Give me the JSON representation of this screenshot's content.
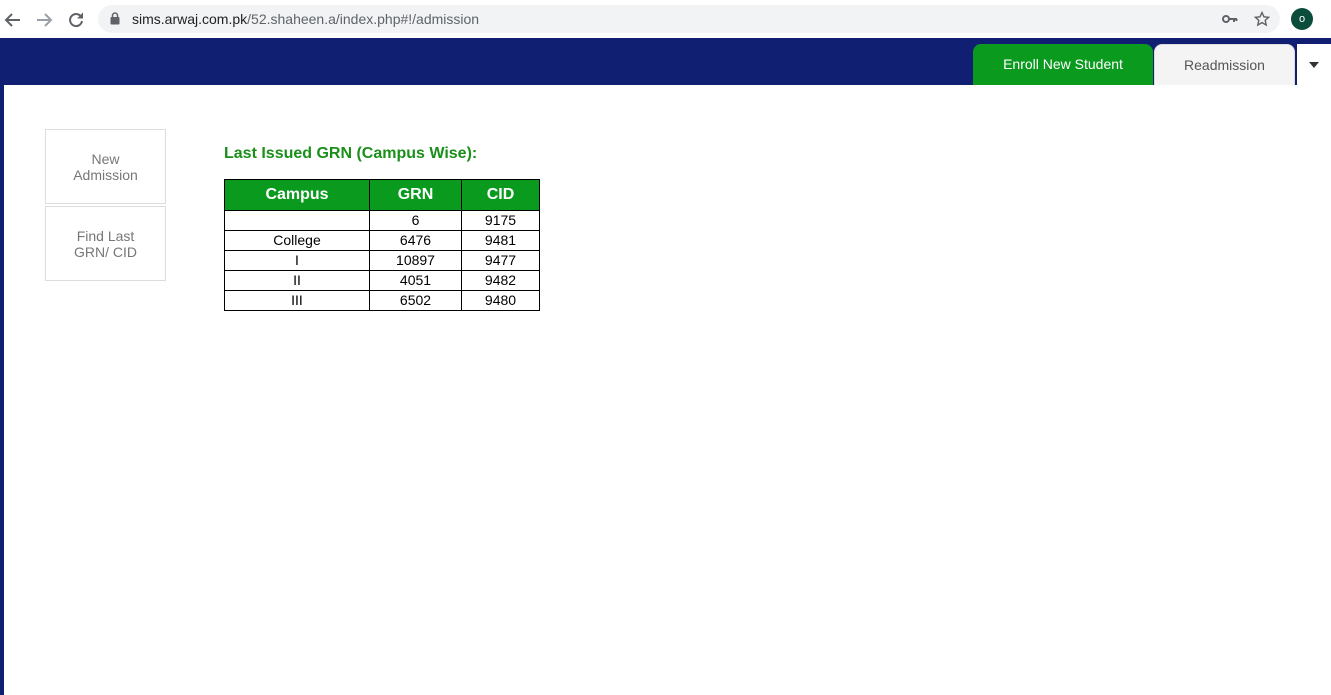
{
  "browser": {
    "url_host": "sims.arwaj.com.pk",
    "url_path": "/52.shaheen.a/index.php#!/admission",
    "profile_initial": "o"
  },
  "header": {
    "tabs": [
      {
        "label": "Enroll New Student",
        "active": true
      },
      {
        "label": "Readmission",
        "active": false
      }
    ]
  },
  "sidebar": {
    "buttons": [
      {
        "label": "New Admission"
      },
      {
        "label": "Find Last GRN/ CID"
      }
    ]
  },
  "main": {
    "title": "Last Issued GRN (Campus Wise):",
    "table": {
      "headers": [
        "Campus",
        "GRN",
        "CID"
      ],
      "rows": [
        [
          "",
          "6",
          "9175"
        ],
        [
          "College",
          "6476",
          "9481"
        ],
        [
          "I",
          "10897",
          "9477"
        ],
        [
          "II",
          "4051",
          "9482"
        ],
        [
          "III",
          "6502",
          "9480"
        ]
      ]
    }
  },
  "colors": {
    "header_bg": "#111f73",
    "accent_green": "#0a9a1e",
    "title_green": "#1a8f1a"
  }
}
